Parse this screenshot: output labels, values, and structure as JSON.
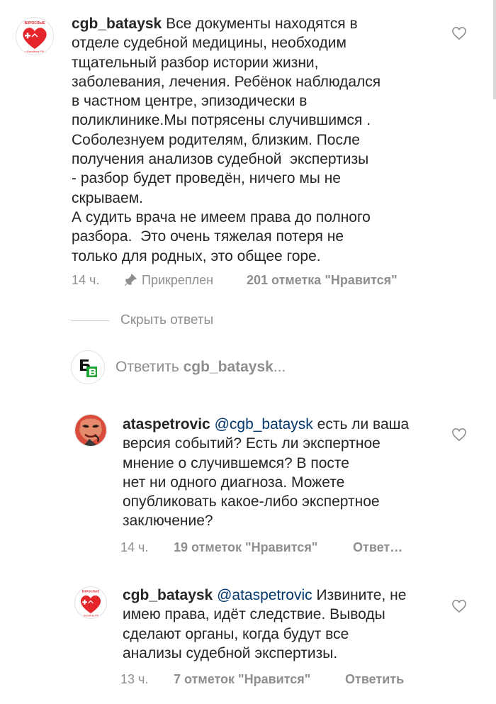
{
  "comments": [
    {
      "username": "cgb_bataysk",
      "text": "Все документы находятся в\nотделе судебной медицины, необходим\nтщательный разбор истории жизни,\nзаболевания, лечения. Ребёнок наблюдался\nв частном центре, эпизодически в\nполиклинике.Мы потрясены случившимся .\nСоболезнуем родителям, близким. После\nполучения анализов судебной  экспертизы\n- разбор будет проведён, ничего мы не\nскрываем.\nА судить врача не имеем права до полного\nразбора.  Это очень тяжелая потеря не\nтолько для родных, это общее горе.",
      "time": "14 ч.",
      "pinned_label": "Прикреплен",
      "likes": "201 отметка \"Нравится\""
    }
  ],
  "thread": {
    "hide_replies_label": "Скрыть ответы",
    "reply_input": {
      "prefix": "Ответить",
      "target": "cgb_bataysk",
      "suffix": "..."
    }
  },
  "replies": [
    {
      "username": "ataspetrovic",
      "mention": "@cgb_bataysk",
      "text": " есть ли ваша\nверсия событий? Есть ли экспертное\nмнение о случившемся? В посте\nнет ни одного диагноза. Можете\nопубликовать какое-либо экспертное\nзаключение?",
      "time": "14 ч.",
      "likes": "19 отметок \"Нравится\"",
      "reply_label": "Ответ…"
    },
    {
      "username": "cgb_bataysk",
      "mention": "@ataspetrovic",
      "text": " Извините, не\nимею права, идёт следствие. Выводы\nсделают органы, когда будут все\nанализы судебной экспертизы.",
      "time": "13 ч.",
      "likes": "7 отметок \"Нравится\"",
      "reply_label": "Ответить"
    }
  ],
  "avatars": {
    "cgb_bataysk_logo_text_top": "ВЗРОСЛЫЕ",
    "cgb_bataysk_logo_text_bottom": "г.Батайска РФ",
    "bv_letters": "БВ"
  },
  "icons": {
    "heart": "heart-outline-icon",
    "pin": "pin-icon"
  },
  "colors": {
    "logo_red": "#e4252a",
    "bv_green": "#1fa538",
    "text": "#262626",
    "secondary": "#8e8e8e",
    "mention": "#00376b"
  }
}
